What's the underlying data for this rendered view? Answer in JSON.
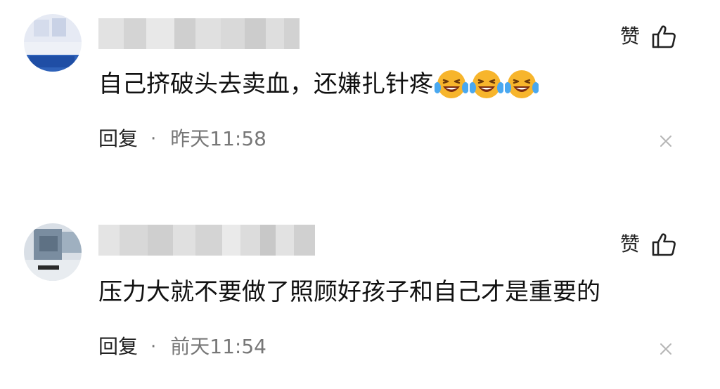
{
  "comments": [
    {
      "like_label": "赞",
      "text": "自己挤破头去卖血，还嫌扎针疼",
      "emoji": [
        "laughing-with-tears",
        "laughing-with-tears",
        "laughing-with-tears"
      ],
      "reply_label": "回复",
      "separator": "·",
      "time": "昨天11:58"
    },
    {
      "like_label": "赞",
      "text": "压力大就不要做了照顾好孩子和自己才是重要的",
      "reply_label": "回复",
      "separator": "·",
      "time": "前天11:54"
    }
  ],
  "colors": {
    "background": "#ffffff",
    "text": "#111111",
    "meta_text": "#777777",
    "emoji_face": "#f7b52c"
  }
}
